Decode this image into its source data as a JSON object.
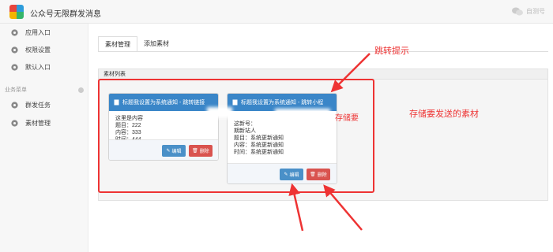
{
  "header": {
    "title": "公众号无限群发消息",
    "user": "自测号"
  },
  "sidebar": {
    "items": [
      {
        "label": "应用入口",
        "icon": "gear-icon"
      },
      {
        "label": "权限设置",
        "icon": "gear-icon"
      },
      {
        "label": "默认入口",
        "icon": "gear-icon"
      }
    ],
    "section_label": "业务菜单",
    "business_items": [
      {
        "label": "群发任务",
        "icon": "gear-icon"
      },
      {
        "label": "素材管理",
        "icon": "gear-icon"
      }
    ]
  },
  "tabs": [
    {
      "label": "素材管理"
    },
    {
      "label": "添加素材"
    }
  ],
  "panel": {
    "title": "素材列表"
  },
  "cards": [
    {
      "title": "标题我设置为系统通知 - 跳转链接",
      "lines": [
        "这里是内容",
        "题目：222",
        "内容：333",
        "时间：444"
      ],
      "edit_label": "编辑",
      "delete_label": "删除"
    },
    {
      "title": "标题我设置为系统通知 - 跳转小程",
      "lines": [
        "这新号：",
        "期新站人",
        "题目：系统更新通知",
        "内容：系统更新通知",
        "时间：系统更新通知"
      ],
      "edit_label": "编辑",
      "delete_label": "删除"
    }
  ],
  "annotations": {
    "jump_hint": "跳转提示",
    "store_material": "存储要发送的素材",
    "store_partial": "存储要"
  },
  "colors": {
    "accent": "#3a86c8",
    "danger": "#d9534f",
    "annotation": "#e33333"
  }
}
